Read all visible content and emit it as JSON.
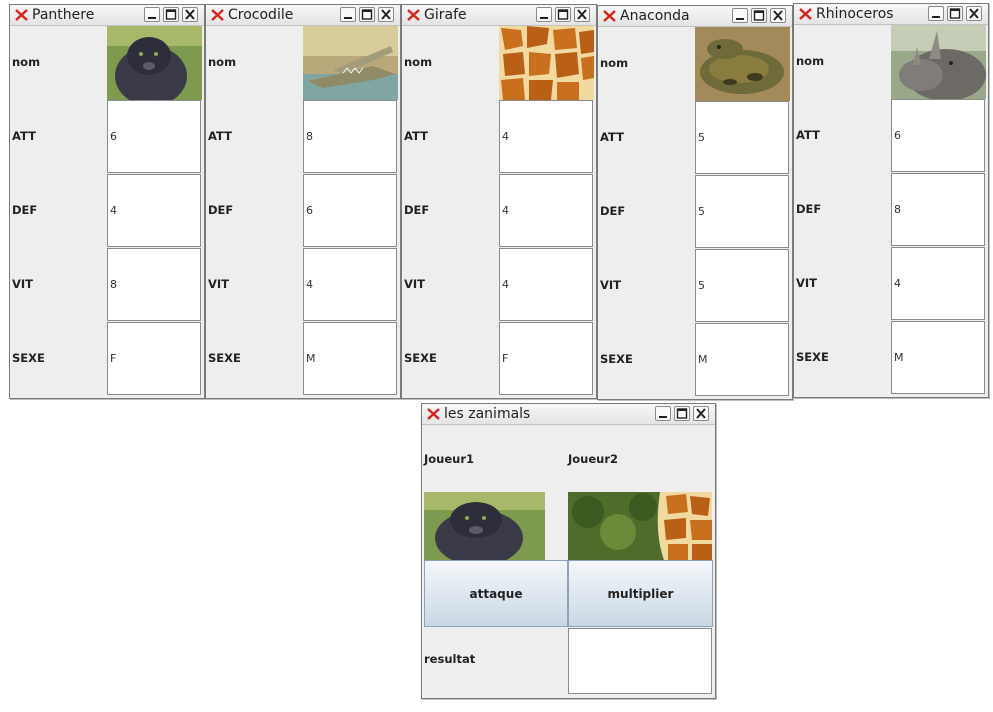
{
  "windows": [
    {
      "title": "Panthere",
      "labels": {
        "nom": "nom",
        "att": "ATT",
        "def": "DEF",
        "vit": "VIT",
        "sexe": "SEXE"
      },
      "values": {
        "att": "6",
        "def": "4",
        "vit": "8",
        "sexe": "F"
      },
      "image": "panther-photo"
    },
    {
      "title": "Crocodile",
      "labels": {
        "nom": "nom",
        "att": "ATT",
        "def": "DEF",
        "vit": "VIT",
        "sexe": "SEXE"
      },
      "values": {
        "att": "8",
        "def": "6",
        "vit": "4",
        "sexe": "M"
      },
      "image": "crocodile-photo"
    },
    {
      "title": "Girafe",
      "labels": {
        "nom": "nom",
        "att": "ATT",
        "def": "DEF",
        "vit": "VIT",
        "sexe": "SEXE"
      },
      "values": {
        "att": "4",
        "def": "4",
        "vit": "4",
        "sexe": "F"
      },
      "image": "giraffe-photo"
    },
    {
      "title": "Anaconda",
      "labels": {
        "nom": "nom",
        "att": "ATT",
        "def": "DEF",
        "vit": "VIT",
        "sexe": "SEXE"
      },
      "values": {
        "att": "5",
        "def": "5",
        "vit": "5",
        "sexe": "M"
      },
      "image": "anaconda-photo"
    },
    {
      "title": "Rhinoceros",
      "labels": {
        "nom": "nom",
        "att": "ATT",
        "def": "DEF",
        "vit": "VIT",
        "sexe": "SEXE"
      },
      "values": {
        "att": "6",
        "def": "8",
        "vit": "4",
        "sexe": "M"
      },
      "image": "rhinoceros-photo"
    }
  ],
  "main": {
    "title": "les zanimals",
    "player1": "Joueur1",
    "player2": "Joueur2",
    "attack_button": "attaque",
    "multiply_button": "multiplier",
    "result_label": "resultat",
    "result_value": ""
  },
  "colors": {
    "window_bg": "#eeeeee",
    "close_x": "#d8221a",
    "button_top": "#f4f7fa",
    "button_bottom": "#c9d6e3"
  }
}
